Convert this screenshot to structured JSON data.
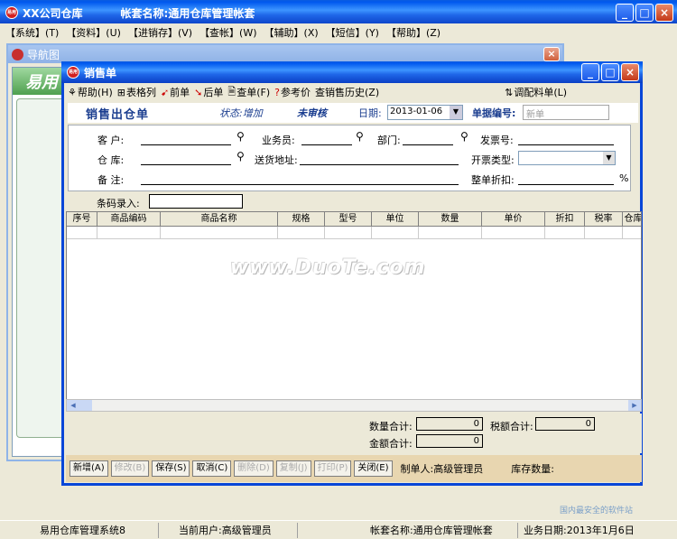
{
  "main_window": {
    "title_app": "XX公司仓库",
    "title_account_label": "帐套名称:",
    "title_account_name": "通用仓库管理帐套",
    "min_btn": "_",
    "max_btn": "□",
    "close_btn": "×"
  },
  "menu": [
    "【系统】(T)",
    "【资料】(U)",
    "【进销存】(V)",
    "【查帐】(W)",
    "【辅助】(X)",
    "【短信】(Y)",
    "【帮助】(Z)"
  ],
  "nav_window": {
    "title": "导航图",
    "logo": "易用",
    "close_btn": "×"
  },
  "sales_window": {
    "title": "销售单",
    "close_btn": "×",
    "toolbar": {
      "help": "帮助(H)",
      "table_format": "表格列",
      "prev": "前单",
      "next": "后单",
      "find": "查单(F)",
      "ref_price": "参考价",
      "history": "查销售历史(Z)",
      "transfer": "调配料单(L)"
    },
    "header": {
      "doc_title": "销售出仓单",
      "status_add": "状态:增加",
      "status_audit": "未审核",
      "date_label": "日期:",
      "date_value": "2013-01-06",
      "docno_label": "单据编号:",
      "docno_placeholder": "新单"
    },
    "form": {
      "customer": "客  户:",
      "salesman": "业务员:",
      "dept": "部门:",
      "invoice_no": "发票号:",
      "warehouse": "仓  库:",
      "delivery_addr": "送货地址:",
      "invoice_type": "开票类型:",
      "remark": "备  注:",
      "discount": "整单折扣:",
      "percent": "%"
    },
    "barcode_label": "条码录入:",
    "grid_columns": [
      "序号",
      "商品编码",
      "商品名称",
      "规格",
      "型号",
      "单位",
      "数量",
      "单价",
      "折扣",
      "税率",
      "仓库"
    ],
    "totals": {
      "qty_label": "数量合计:",
      "qty_value": "0",
      "tax_label": "税额合计:",
      "tax_value": "0",
      "amount_label": "金额合计:",
      "amount_value": "0"
    },
    "buttons": {
      "new": "新增(A)",
      "edit": "修改(B)",
      "save": "保存(S)",
      "cancel": "取消(C)",
      "delete": "删除(D)",
      "copy": "复制(J)",
      "print": "打印(P)",
      "close": "关闭(E)"
    },
    "maker": "制单人:高级管理员",
    "stock_qty_label": "库存数量:"
  },
  "watermark": "www.DuoTe.com",
  "status_bar": {
    "system": "易用仓库管理系统8",
    "user": "当前用户:高级管理员",
    "account": "帐套名称:通用仓库管理帐套",
    "biz_date": "业务日期:2013年1月6日"
  },
  "watermark2": "国内最安全的软件站"
}
